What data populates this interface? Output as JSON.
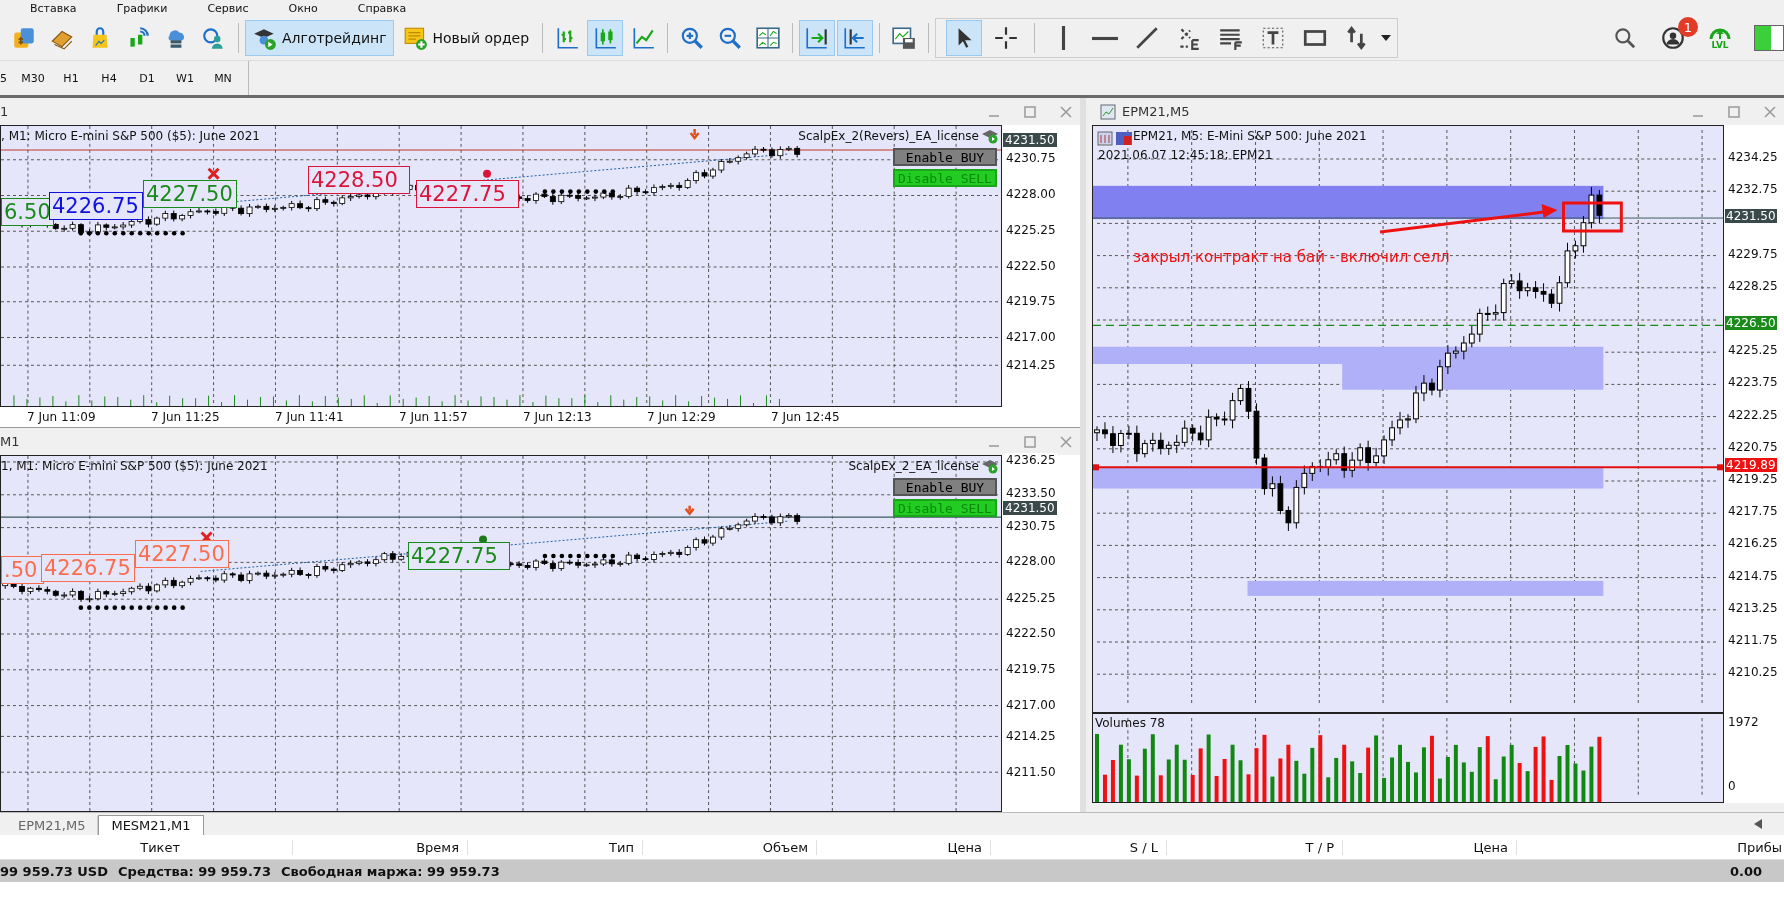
{
  "menu": [
    "Вставка",
    "Графики",
    "Сервис",
    "Окно",
    "Справка"
  ],
  "toolbar": {
    "algo_trading": {
      "label": "Алготрейдинг",
      "selected": true
    },
    "new_order": {
      "label": "Новый ордер"
    },
    "chart_buttons": [
      {
        "selected": false
      },
      {
        "selected": true
      },
      {
        "selected": false
      },
      {
        "selected": false
      },
      {
        "selected": false
      },
      {
        "selected": false
      },
      {
        "selected": true
      },
      {
        "selected": true
      },
      {
        "selected": false
      }
    ],
    "drawing_tools": [
      {
        "selected": true
      },
      {
        "selected": false
      },
      {
        "selected": false
      },
      {
        "selected": false
      },
      {
        "selected": false
      },
      {
        "selected": false
      },
      {
        "selected": false
      },
      {
        "selected": false
      },
      {
        "selected": false
      },
      {
        "selected": false
      }
    ],
    "notification_badge": "1",
    "level_label": "LVL"
  },
  "timeframes": [
    "5",
    "M30",
    "H1",
    "H4",
    "D1",
    "W1",
    "MN"
  ],
  "charts": [
    {
      "title": "1",
      "info": ", M1:  Micro E-mini S&P 500 ($5): June 2021",
      "ea_label": "ScalpEx_2(Revers)_EA_license",
      "buttons": [
        {
          "label": "Enable BUY",
          "active": false
        },
        {
          "label": "Disable SELL",
          "active": true
        }
      ],
      "price_axis": [
        "4230.75",
        "4228.00",
        "4225.25",
        "4222.50",
        "4219.75",
        "4217.00",
        "4214.25"
      ],
      "current_price": "4231.50",
      "time_axis": [
        "7 Jun 11:09",
        "7 Jun 11:25",
        "7 Jun 11:41",
        "7 Jun 11:57",
        "7 Jun 12:13",
        "7 Jun 12:29",
        "7 Jun 12:45"
      ],
      "price_labels": [
        {
          "text": "6.50",
          "color": "#1a8a1a"
        },
        {
          "text": "4226.75",
          "color": "#1010e0"
        },
        {
          "text": "4227.50",
          "color": "#1a8a1a"
        },
        {
          "text": "4228.50",
          "color": "#dc143c"
        },
        {
          "text": "4227.75",
          "color": "#dc143c"
        }
      ]
    },
    {
      "title": "M1",
      "info": "1, M1:  Micro E-mini S&P 500 ($5): June 2021",
      "ea_label": "ScalpEx_2_EA_license",
      "buttons": [
        {
          "label": "Enable BUY",
          "active": false
        },
        {
          "label": "Disable SELL",
          "active": true
        }
      ],
      "price_axis": [
        "4236.25",
        "4233.50",
        "4230.75",
        "4228.00",
        "4225.25",
        "4222.50",
        "4219.75",
        "4217.00",
        "4214.25",
        "4211.50"
      ],
      "current_price": "4231.50",
      "price_labels": [
        {
          "text": ".50",
          "color": "#fa6e4f"
        },
        {
          "text": "4226.75",
          "color": "#fa6e4f"
        },
        {
          "text": "4227.50",
          "color": "#fa6e4f"
        },
        {
          "text": "4227.75",
          "color": "#1a8a1a"
        }
      ]
    }
  ],
  "right_chart": {
    "title": "EPM21,M5",
    "info": "EPM21, M5:  E-Mini S&P 500: June 2021",
    "timestamp": "2021.06.07 12:45:18; EPM21",
    "annotation": "закрыл контракт на бай - включил селл",
    "price_axis": [
      {
        "price": "4234.25",
        "kind": "tick"
      },
      {
        "price": "4232.75",
        "kind": "tick"
      },
      {
        "price": "4231.50",
        "kind": "current"
      },
      {
        "price": "4229.75",
        "kind": "tick"
      },
      {
        "price": "4228.25",
        "kind": "tick"
      },
      {
        "price": "4226.50",
        "kind": "level"
      },
      {
        "price": "4225.25",
        "kind": "tick"
      },
      {
        "price": "4223.75",
        "kind": "tick"
      },
      {
        "price": "4222.25",
        "kind": "tick"
      },
      {
        "price": "4220.75",
        "kind": "tick"
      },
      {
        "price": "4219.89",
        "kind": "alert"
      },
      {
        "price": "4219.25",
        "kind": "tick"
      },
      {
        "price": "4217.75",
        "kind": "tick"
      },
      {
        "price": "4216.25",
        "kind": "tick"
      },
      {
        "price": "4214.75",
        "kind": "tick"
      },
      {
        "price": "4213.25",
        "kind": "tick"
      },
      {
        "price": "4211.75",
        "kind": "tick"
      },
      {
        "price": "4210.25",
        "kind": "tick"
      }
    ],
    "volume_label": "Volumes 78",
    "volume_max": "1972",
    "volume_min": "0"
  },
  "tabs": [
    {
      "label": "EPM21,M5",
      "selected": false
    },
    {
      "label": "MESM21,M1",
      "selected": true
    }
  ],
  "trade_table": {
    "columns": [
      "Тикет",
      "Время",
      "Тип",
      "Объем",
      "Цена",
      "S / L",
      "T / P",
      "Цена",
      "Прибы"
    ]
  },
  "status": {
    "balance": "99 959.73 USD",
    "equity": "Средства: 99 959.73",
    "free_margin": "Свободная маржа: 99 959.73",
    "profit": "0.00"
  }
}
